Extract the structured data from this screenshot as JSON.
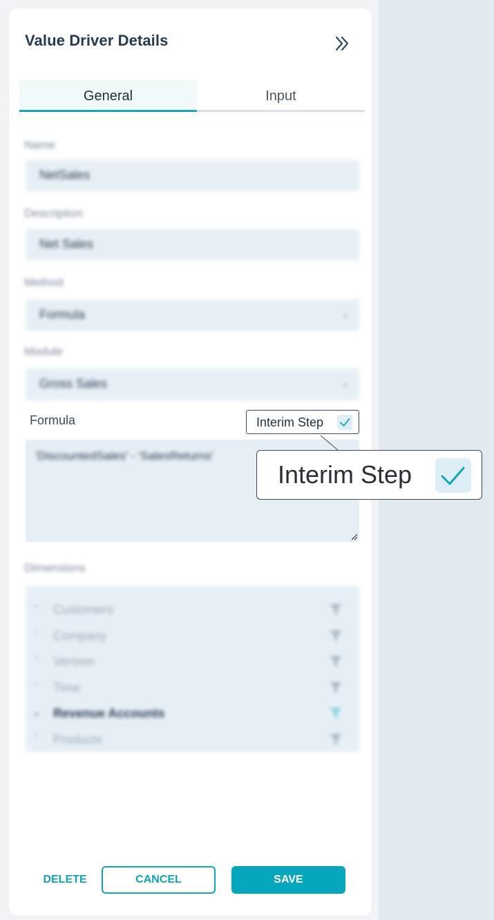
{
  "panel": {
    "title": "Value Driver Details"
  },
  "tabs": [
    {
      "label": "General"
    },
    {
      "label": "Input"
    }
  ],
  "fields": {
    "name": {
      "label": "Name",
      "value": "NetSales"
    },
    "description": {
      "label": "Description",
      "value": "Net Sales"
    },
    "method": {
      "label": "Method",
      "value": "Formula"
    },
    "module": {
      "label": "Module",
      "value": "Gross Sales"
    }
  },
  "formula": {
    "label": "Formula",
    "value": "'DiscountedSales' - 'SalesReturns'",
    "interim_step": {
      "label": "Interim Step",
      "checked": true
    }
  },
  "dimensions": {
    "label": "Dimensions",
    "items": [
      {
        "name": "Customers",
        "expanded": false
      },
      {
        "name": "Company",
        "expanded": false
      },
      {
        "name": "Version",
        "expanded": false
      },
      {
        "name": "Time",
        "expanded": false
      },
      {
        "name": "Revenue Accounts",
        "expanded": true,
        "active": true
      },
      {
        "name": "Products",
        "expanded": false
      }
    ]
  },
  "actions": {
    "delete": "DELETE",
    "cancel": "CANCEL",
    "save": "SAVE"
  },
  "zoom_callout": {
    "label": "Interim Step"
  },
  "colors": {
    "accent": "#06a6bc",
    "title": "#243a4f",
    "field_bg": "#e7eff6"
  },
  "icons": {
    "collapse": "double-chevron-right-icon",
    "check": "check-icon",
    "filter": "filter-icon",
    "chevron": "chevron-down-icon"
  }
}
